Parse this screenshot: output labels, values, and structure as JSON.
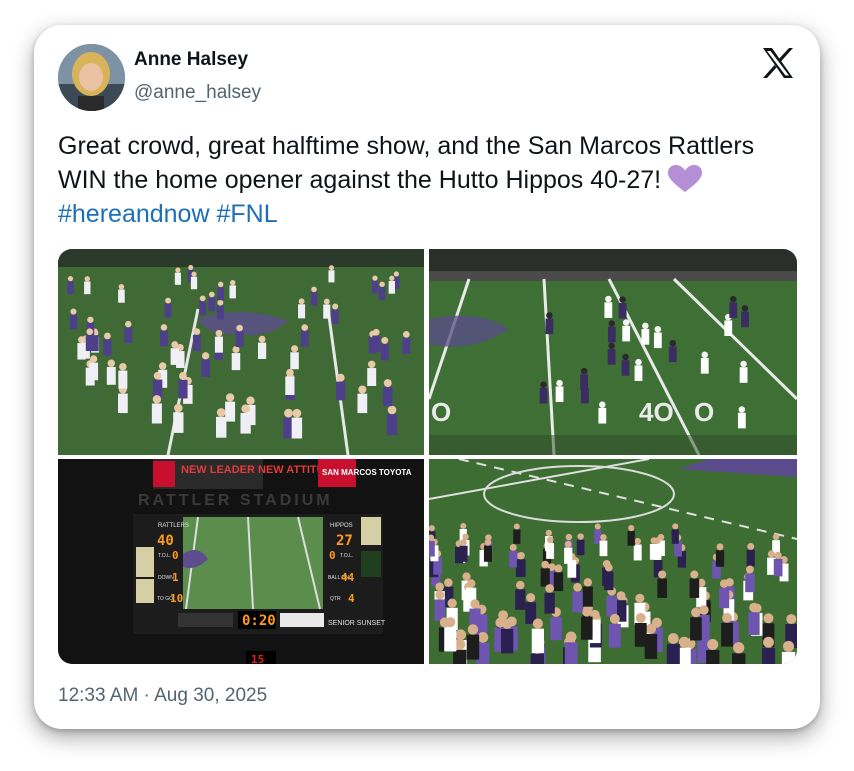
{
  "author": {
    "name": "Anne Halsey",
    "handle": "@anne_halsey"
  },
  "post": {
    "text_main": "Great crowd, great halftime show, and the San Marcos Rattlers WIN the home opener against the Hutto Hippos 40-27! ",
    "hashtags": [
      "#hereandnow",
      "#FNL"
    ],
    "emoji": "purple-heart"
  },
  "timestamp": "12:33 AM · Aug 30, 2025",
  "scoreboard": {
    "sponsor_left": "NEW LEADER NEW ATTITUDE",
    "sponsor_right": "SAN MARCOS TOYOTA",
    "stadium": "RATTLER STADIUM",
    "home_label": "RATTLERS",
    "home_score": "40",
    "home_tol": "0",
    "away_label": "HIPPOS",
    "away_score": "27",
    "away_tol": "0",
    "tol_label": "T.O.L.",
    "down_label": "DOWN",
    "down": "1",
    "togo_label": "TO GO",
    "togo": "10",
    "ballon_label": "BALL ON",
    "ballon": "44",
    "qtr_label": "QTR",
    "qtr": "4",
    "clock": "0:20",
    "footer": "SENIOR SUNSET",
    "play_clock": "15"
  },
  "colors": {
    "link": "#1d6fb8",
    "text": "#0f1419",
    "muted": "#536471",
    "heart": "#b48fd6",
    "field": "#3d6b34"
  }
}
